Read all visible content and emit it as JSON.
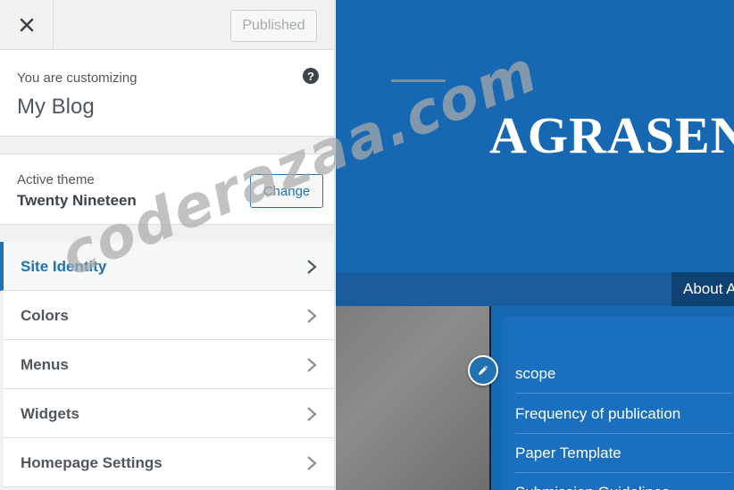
{
  "header": {
    "close_icon": "close-icon",
    "publish_label": "Published"
  },
  "customizing": {
    "label": "You are customizing",
    "site_name": "My Blog",
    "help_icon": "help-icon"
  },
  "theme": {
    "label": "Active theme",
    "name": "Twenty Nineteen",
    "change_label": "Change"
  },
  "panels": [
    {
      "label": "Site Identity",
      "active": true
    },
    {
      "label": "Colors"
    },
    {
      "label": "Menus"
    },
    {
      "label": "Widgets"
    },
    {
      "label": "Homepage Settings"
    }
  ],
  "preview": {
    "site_title": "AGRASEN",
    "nav_item": "About A",
    "menu_links": [
      "scope",
      "Frequency of publication",
      "Paper Template",
      "Submission Guidelines"
    ],
    "edit_icon": "pencil-icon"
  },
  "watermark": "coderazaa.com",
  "colors": {
    "accent": "#2271b1",
    "preview_bg": "#1768b3"
  }
}
